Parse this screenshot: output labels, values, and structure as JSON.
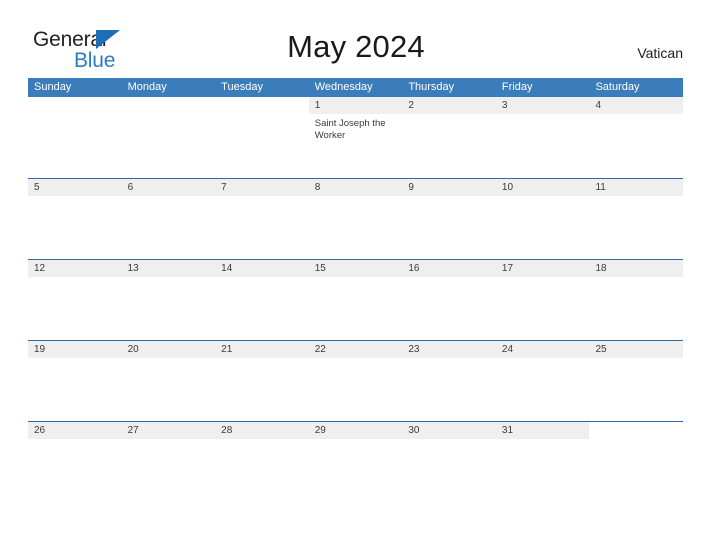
{
  "brand": {
    "name_part1": "General",
    "name_part2": "Blue",
    "flag_color": "#1d6eb7",
    "blue_text_color": "#2b7cc4"
  },
  "header": {
    "title": "May 2024",
    "region": "Vatican"
  },
  "calendar": {
    "month": "May",
    "year": "2024",
    "accent_color": "#3b7cba",
    "rule_color": "#2b6da8",
    "date_band_color": "#efefef",
    "weekdays": [
      "Sunday",
      "Monday",
      "Tuesday",
      "Wednesday",
      "Thursday",
      "Friday",
      "Saturday"
    ],
    "weeks": [
      [
        {
          "day": "",
          "blank": true,
          "events": []
        },
        {
          "day": "",
          "blank": true,
          "events": []
        },
        {
          "day": "",
          "blank": true,
          "events": []
        },
        {
          "day": "1",
          "blank": false,
          "events": [
            "Saint Joseph the Worker"
          ]
        },
        {
          "day": "2",
          "blank": false,
          "events": []
        },
        {
          "day": "3",
          "blank": false,
          "events": []
        },
        {
          "day": "4",
          "blank": false,
          "events": []
        }
      ],
      [
        {
          "day": "5",
          "blank": false,
          "events": []
        },
        {
          "day": "6",
          "blank": false,
          "events": []
        },
        {
          "day": "7",
          "blank": false,
          "events": []
        },
        {
          "day": "8",
          "blank": false,
          "events": []
        },
        {
          "day": "9",
          "blank": false,
          "events": []
        },
        {
          "day": "10",
          "blank": false,
          "events": []
        },
        {
          "day": "11",
          "blank": false,
          "events": []
        }
      ],
      [
        {
          "day": "12",
          "blank": false,
          "events": []
        },
        {
          "day": "13",
          "blank": false,
          "events": []
        },
        {
          "day": "14",
          "blank": false,
          "events": []
        },
        {
          "day": "15",
          "blank": false,
          "events": []
        },
        {
          "day": "16",
          "blank": false,
          "events": []
        },
        {
          "day": "17",
          "blank": false,
          "events": []
        },
        {
          "day": "18",
          "blank": false,
          "events": []
        }
      ],
      [
        {
          "day": "19",
          "blank": false,
          "events": []
        },
        {
          "day": "20",
          "blank": false,
          "events": []
        },
        {
          "day": "21",
          "blank": false,
          "events": []
        },
        {
          "day": "22",
          "blank": false,
          "events": []
        },
        {
          "day": "23",
          "blank": false,
          "events": []
        },
        {
          "day": "24",
          "blank": false,
          "events": []
        },
        {
          "day": "25",
          "blank": false,
          "events": []
        }
      ],
      [
        {
          "day": "26",
          "blank": false,
          "events": []
        },
        {
          "day": "27",
          "blank": false,
          "events": []
        },
        {
          "day": "28",
          "blank": false,
          "events": []
        },
        {
          "day": "29",
          "blank": false,
          "events": []
        },
        {
          "day": "30",
          "blank": false,
          "events": []
        },
        {
          "day": "31",
          "blank": false,
          "events": []
        },
        {
          "day": "",
          "blank": true,
          "events": []
        }
      ]
    ]
  }
}
